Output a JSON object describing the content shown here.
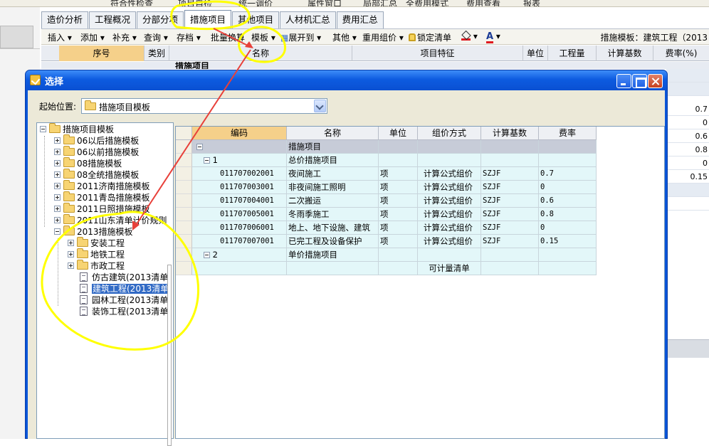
{
  "top_toolbar": [
    "符合性检查",
    "项目自检",
    "统一调价",
    "费用查看",
    "属性窗口",
    "局部汇总",
    "全费用模式",
    "报表"
  ],
  "tabs": [
    "造价分析",
    "工程概况",
    "分部分项",
    "措施项目",
    "其他项目",
    "人材机汇总",
    "费用汇总"
  ],
  "active_tab": "措施项目",
  "ribbon": {
    "items": [
      "插入",
      "添加",
      "补充",
      "查询",
      "存档",
      "批量换算",
      "模板",
      "展开到",
      "其他",
      "重用组价",
      "锁定清单"
    ],
    "right_text": "措施模板：建筑工程（2013"
  },
  "grid": {
    "headers": [
      "序号",
      "类别",
      "名称",
      "项目特征",
      "单位",
      "工程量",
      "计算基数",
      "费率(%)"
    ],
    "first_row": "措施项目",
    "right_values": [
      "0.7",
      "0",
      "0.6",
      "0.8",
      "0",
      "0.15"
    ]
  },
  "dialog": {
    "title": "选择",
    "start_label": "起始位置:",
    "start_value": "措施项目模板",
    "tree": {
      "root": "措施项目模板",
      "items": [
        "06以后措施模板",
        "06以前措施模板",
        "08措施模板",
        "08全统措施模板",
        "2011济南措施模板",
        "2011青岛措施模板",
        "2011日照措施模板",
        "2011山东清单计价规则",
        "2013措施模板"
      ],
      "sub_folders": [
        "安装工程",
        "地铁工程",
        "市政工程"
      ],
      "docs": [
        "仿古建筑(2013清单",
        "建筑工程(2013清单",
        "园林工程(2013清单",
        "装饰工程(2013清单"
      ],
      "selected": "建筑工程(2013清单"
    },
    "table": {
      "headers": [
        "编码",
        "名称",
        "单位",
        "组价方式",
        "计算基数",
        "费率"
      ],
      "rows": [
        {
          "code": "",
          "name": "措施项目",
          "unit": "",
          "method": "",
          "base": "",
          "rate": ""
        },
        {
          "code": "1",
          "name": "总价措施项目",
          "unit": "",
          "method": "",
          "base": "",
          "rate": ""
        },
        {
          "code": "011707002001",
          "name": "夜间施工",
          "unit": "项",
          "method": "计算公式组价",
          "base": "SZJF",
          "rate": "0.7"
        },
        {
          "code": "011707003001",
          "name": "非夜间施工照明",
          "unit": "项",
          "method": "计算公式组价",
          "base": "SZJF",
          "rate": "0"
        },
        {
          "code": "011707004001",
          "name": "二次搬运",
          "unit": "项",
          "method": "计算公式组价",
          "base": "SZJF",
          "rate": "0.6"
        },
        {
          "code": "011707005001",
          "name": "冬雨季施工",
          "unit": "项",
          "method": "计算公式组价",
          "base": "SZJF",
          "rate": "0.8"
        },
        {
          "code": "011707006001",
          "name": "地上、地下设施、建筑",
          "unit": "项",
          "method": "计算公式组价",
          "base": "SZJF",
          "rate": "0"
        },
        {
          "code": "011707007001",
          "name": "已完工程及设备保护",
          "unit": "项",
          "method": "计算公式组价",
          "base": "SZJF",
          "rate": "0.15"
        },
        {
          "code": "2",
          "name": "单价措施项目",
          "unit": "",
          "method": "",
          "base": "",
          "rate": ""
        },
        {
          "code": "",
          "name": "",
          "unit": "",
          "method": "可计量清单",
          "base": "",
          "rate": ""
        }
      ]
    }
  },
  "colors": {
    "titlebar": "#0a55d8",
    "selection": "#316ac5",
    "annotation": "#ffff00",
    "arrow": "#e8403a"
  }
}
